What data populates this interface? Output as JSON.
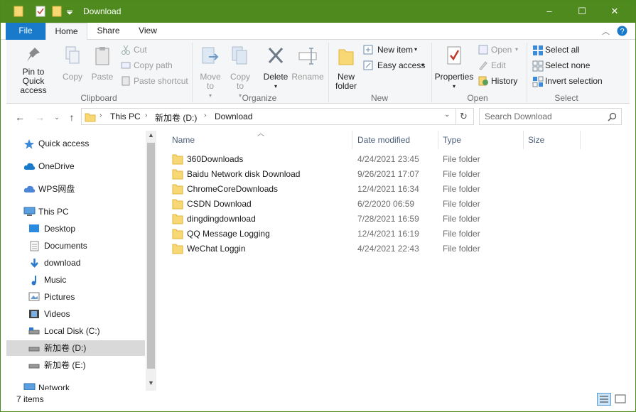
{
  "window": {
    "title": "Download",
    "controls": {
      "minimize": "–",
      "maximize": "☐",
      "close": "✕"
    }
  },
  "ribbon_tabs": [
    "File",
    "Home",
    "Share",
    "View"
  ],
  "ribbon": {
    "clipboard": {
      "pin": "Pin to Quick access",
      "copy": "Copy",
      "paste": "Paste",
      "cut": "Cut",
      "copy_path": "Copy path",
      "paste_shortcut": "Paste shortcut",
      "label": "Clipboard"
    },
    "organize": {
      "move_to": "Move to",
      "copy_to": "Copy to",
      "delete": "Delete",
      "rename": "Rename",
      "label": "Organize"
    },
    "new": {
      "new_folder": "New folder",
      "new_item": "New item",
      "easy_access": "Easy access",
      "label": "New"
    },
    "open": {
      "properties": "Properties",
      "open": "Open",
      "edit": "Edit",
      "history": "History",
      "label": "Open"
    },
    "select": {
      "select_all": "Select all",
      "select_none": "Select none",
      "invert": "Invert selection",
      "label": "Select"
    }
  },
  "address": {
    "breadcrumbs": [
      "This PC",
      "新加卷 (D:)",
      "Download"
    ],
    "search_placeholder": "Search Download"
  },
  "nav": [
    {
      "label": "Quick access",
      "icon": "star-icon"
    },
    {
      "label": "OneDrive",
      "icon": "cloud-icon"
    },
    {
      "label": "WPS网盘",
      "icon": "wps-cloud-icon"
    },
    {
      "label": "This PC",
      "icon": "computer-icon"
    },
    {
      "label": "Desktop",
      "icon": "desktop-icon"
    },
    {
      "label": "Documents",
      "icon": "documents-icon"
    },
    {
      "label": "download",
      "icon": "download-arrow-icon"
    },
    {
      "label": "Music",
      "icon": "music-note-icon"
    },
    {
      "label": "Pictures",
      "icon": "pictures-icon"
    },
    {
      "label": "Videos",
      "icon": "film-icon"
    },
    {
      "label": "Local Disk (C:)",
      "icon": "drive-icon"
    },
    {
      "label": "新加卷 (D:)",
      "icon": "drive-icon",
      "selected": true
    },
    {
      "label": "新加卷 (E:)",
      "icon": "drive-icon"
    },
    {
      "label": "Network",
      "icon": "network-icon"
    }
  ],
  "columns": [
    "Name",
    "Date modified",
    "Type",
    "Size"
  ],
  "files": [
    {
      "name": "360Downloads",
      "date": "4/24/2021 23:45",
      "type": "File folder"
    },
    {
      "name": "Baidu Network disk Download",
      "date": "9/26/2021 17:07",
      "type": "File folder"
    },
    {
      "name": "ChromeCoreDownloads",
      "date": "12/4/2021 16:34",
      "type": "File folder"
    },
    {
      "name": "CSDN Download",
      "date": "6/2/2020 06:59",
      "type": "File folder"
    },
    {
      "name": "dingdingdownload",
      "date": "7/28/2021 16:59",
      "type": "File folder"
    },
    {
      "name": "QQ Message Logging",
      "date": "12/4/2021 16:19",
      "type": "File folder"
    },
    {
      "name": "WeChat Loggin",
      "date": "4/24/2021 22:43",
      "type": "File folder"
    }
  ],
  "status": {
    "item_count": "7 items"
  },
  "colors": {
    "titlebar": "#4e8a1e",
    "file_tab": "#1979ca",
    "folder": "#f8d775",
    "selected_nav": "#d9d9d9"
  }
}
